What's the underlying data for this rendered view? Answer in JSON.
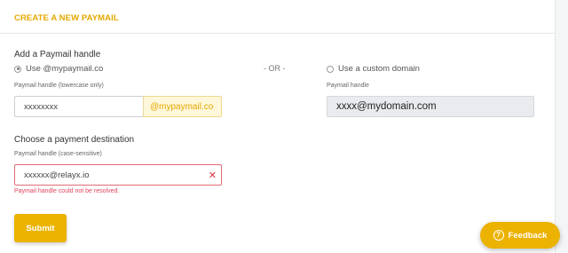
{
  "header": {
    "title": "CREATE A NEW PAYMAIL"
  },
  "handle_section": {
    "title": "Add a Paymail handle",
    "option_mypaymail": "Use @mypaymail.co",
    "or_separator": "- OR -",
    "option_custom": "Use a custom domain",
    "mypaymail_selected": true,
    "left_field_label": "Paymail handle (lowercase only)",
    "left_input_value": "xxxxxxxx",
    "left_input_suffix": "@mypaymail.co",
    "right_field_label": "Paymail handle",
    "right_input_value": "xxxx@mydomain.com"
  },
  "destination_section": {
    "title": "Choose a payment destination",
    "field_label": "Paymail handle (case-sensitive)",
    "input_value": "xxxxxx@relayx.io",
    "error_icon": "✕",
    "error_message": "Paymail handle could not be resolved."
  },
  "actions": {
    "submit_label": "Submit"
  },
  "feedback": {
    "label": "Feedback",
    "icon": "?"
  }
}
